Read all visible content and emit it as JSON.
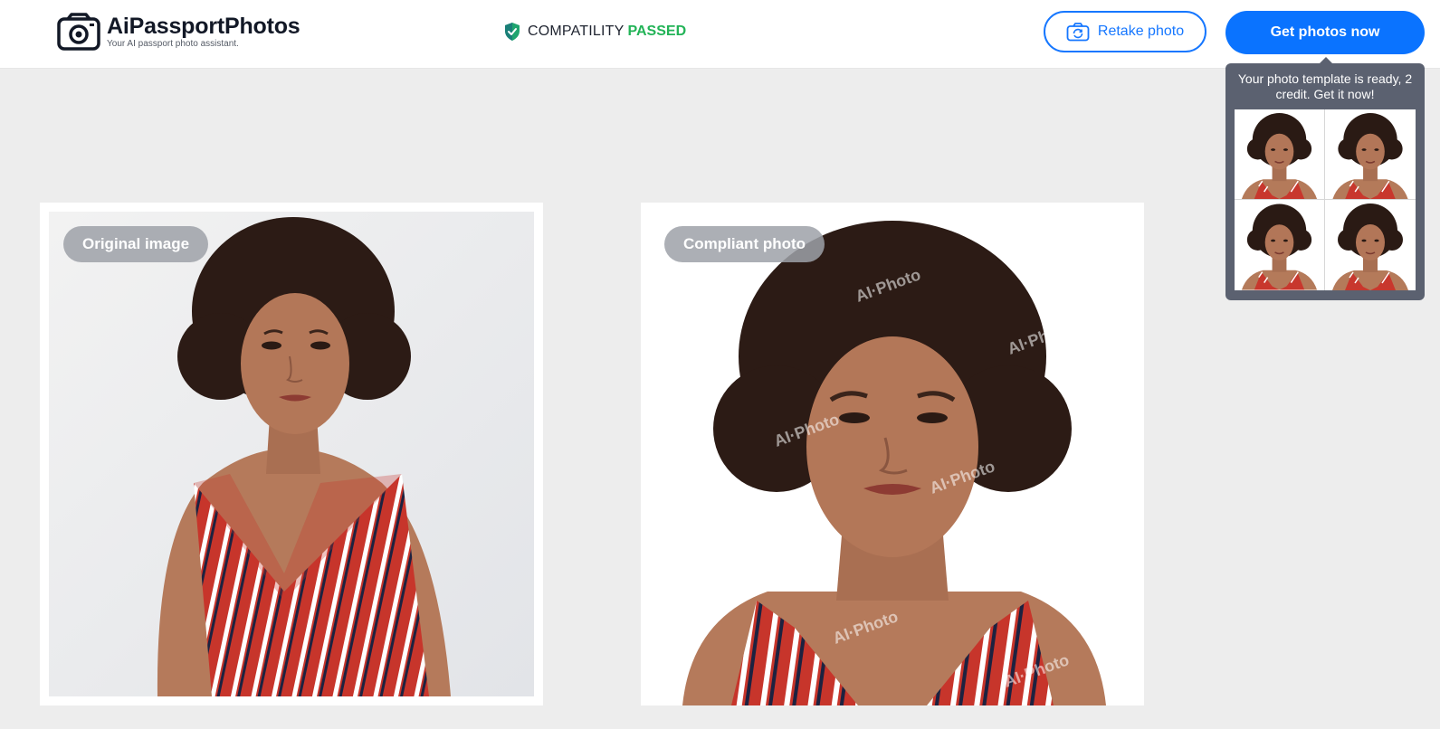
{
  "header": {
    "app_title": "AiPassportPhotos",
    "app_subtitle": "Your AI passport photo assistant.",
    "compat_label": "COMPATILITY",
    "compat_status": "PASSED",
    "retake_label": "Retake photo",
    "get_photos_label": "Get photos now"
  },
  "tooltip": {
    "message": "Your photo template is ready, 2 credit. Get it now!",
    "thumbnail_count": 4
  },
  "panels": {
    "original_label": "Original image",
    "compliant_label": "Compliant photo",
    "watermark": "AI·Photo"
  },
  "icons": {
    "logo": "camera-icon",
    "compat": "shield-check-icon",
    "retake": "camera-rotate-icon"
  },
  "colors": {
    "accent": "#0a73ff",
    "passed": "#22b357",
    "tooltip_bg": "#5b6170",
    "page_bg": "#ededed"
  }
}
